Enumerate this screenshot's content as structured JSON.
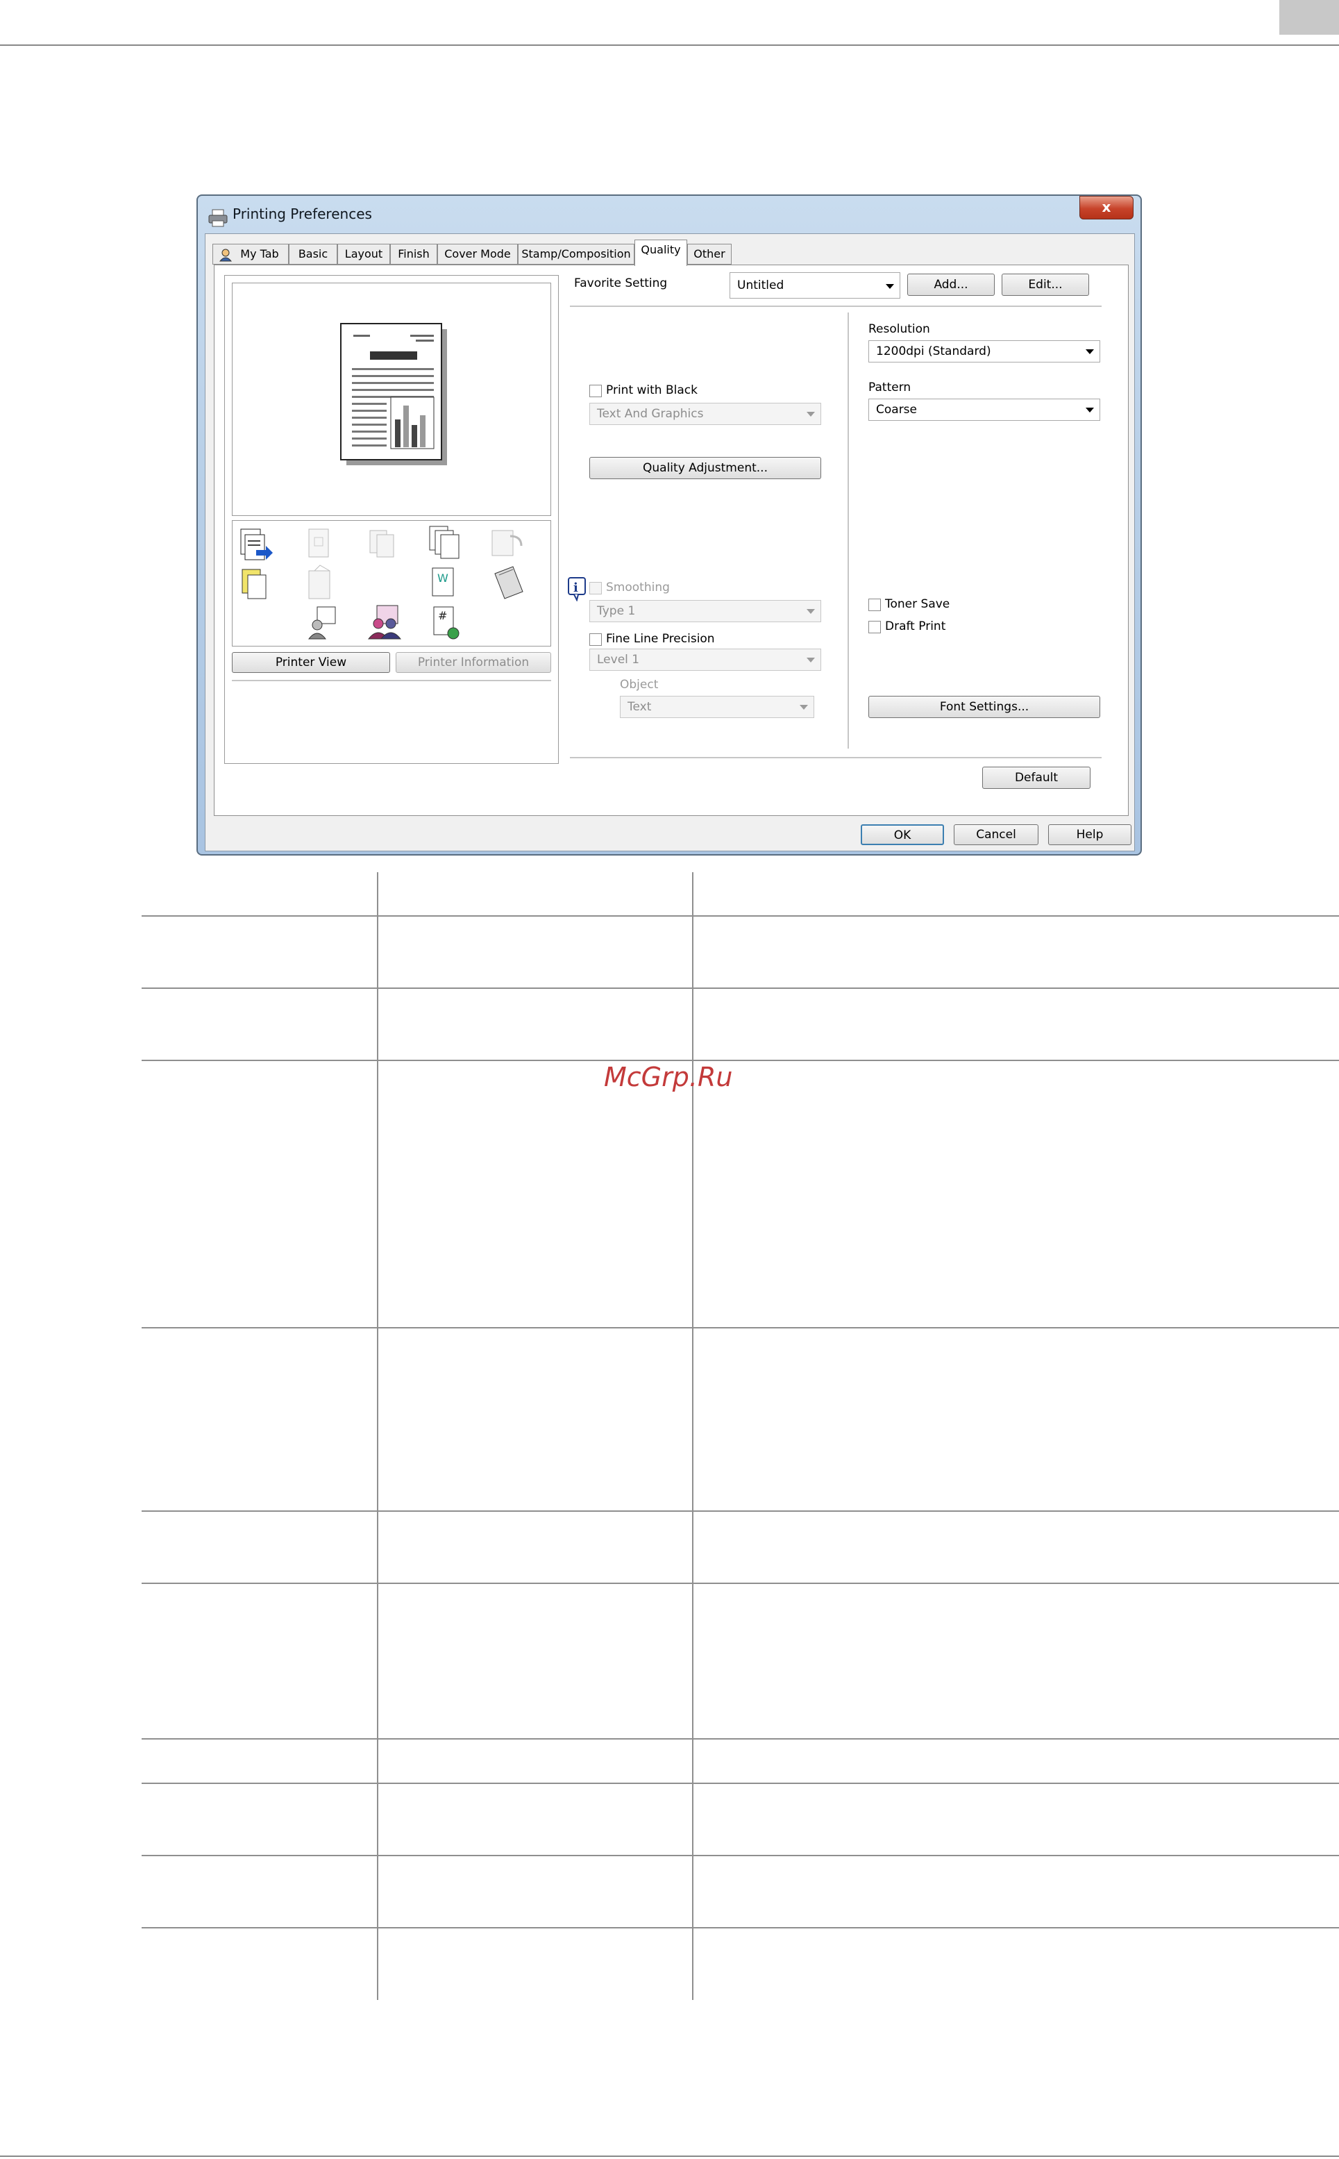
{
  "dialog": {
    "title": "Printing Preferences",
    "close_label": "x",
    "tabs": [
      "My Tab",
      "Basic",
      "Layout",
      "Finish",
      "Cover Mode",
      "Stamp/Composition",
      "Quality",
      "Other"
    ],
    "active_tab": "Quality",
    "favorite_setting_label": "Favorite Setting",
    "favorite_setting_value": "Untitled",
    "add_label": "Add...",
    "edit_label": "Edit...",
    "printer_view_label": "Printer View",
    "printer_information_label": "Printer Information",
    "print_with_black_label": "Print with Black",
    "print_with_black_value": "Text And Graphics",
    "quality_adjustment_label": "Quality Adjustment...",
    "smoothing_label": "Smoothing",
    "smoothing_value": "Type 1",
    "fine_line_label": "Fine Line Precision",
    "fine_line_value": "Level 1",
    "object_label": "Object",
    "object_value": "Text",
    "resolution_label": "Resolution",
    "resolution_value": "1200dpi (Standard)",
    "pattern_label": "Pattern",
    "pattern_value": "Coarse",
    "toner_save_label": "Toner Save",
    "draft_print_label": "Draft Print",
    "font_settings_label": "Font Settings...",
    "default_label": "Default",
    "ok_label": "OK",
    "cancel_label": "Cancel",
    "help_label": "Help",
    "colors": {
      "title_bar": "#b9d0e8",
      "close_button": "#c7432a"
    }
  },
  "watermark": "McGrp.Ru"
}
